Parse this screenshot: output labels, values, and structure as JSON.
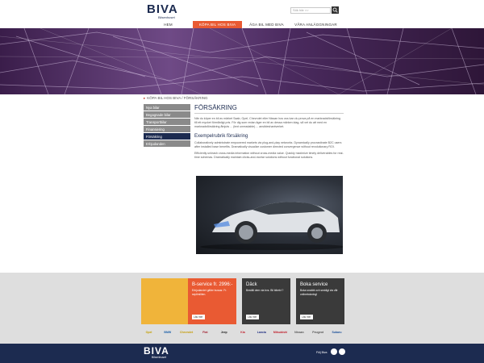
{
  "header": {
    "logo_text": "BIVA",
    "logo_sub": "Bilsenhuset",
    "search_placeholder": "Sök här >>"
  },
  "nav": {
    "items": [
      {
        "label": "Hem"
      },
      {
        "label": "Köpa bil hos Biva"
      },
      {
        "label": "Äga bil med Biva"
      },
      {
        "label": "Våra anläggningar"
      }
    ]
  },
  "breadcrumb": "Köpa bil hos Biva / Försäkring",
  "sidebar": {
    "items": [
      {
        "label": "Nya bilar"
      },
      {
        "label": "Begagnade bilar"
      },
      {
        "label": "Transportbilar"
      },
      {
        "label": "Finansiering"
      },
      {
        "label": "Försäkring"
      },
      {
        "label": "Erbjudanden"
      }
    ]
  },
  "content": {
    "title": "Försäkring",
    "intro": "När du köper en bil av märket Saab, Opel, Chevrolet eller Nissan hos oss kan du prova på en marknadsförsäkring till ett mycket förmånligt pris. För dig som redan äger en bil av dessa märken idag, så vet du att med en marknadsförsäkring åtnjuts ... (text unreadable) ... ansikteshantverket.",
    "subtitle": "Exempelrubrik försäkring",
    "para1": "Collaboratively administrate empowered markets via plug-and-play networks. Dynamically procrastinate B2C users after installed base benefits. Dramatically visualize customer directed convergence without revolutionary ROI.",
    "para2": "Efficiently unleash cross-media information without cross-media value. Quickly maximize timely deliverables for real-time schemas. Dramatically maintain clicks-and-mortar solutions without functional solutions."
  },
  "promos": [
    {
      "title": "B-service fr. 2996:-",
      "text": "Erbjudandet gäller bussar. Fr. sepilmiliten.",
      "button": "Läs mer",
      "color": "#e95a33"
    },
    {
      "title": "Däck",
      "text": "Beställ dem via bvs. Bil bibekt ?",
      "button": "Läs mer",
      "color": "#3a3a3a"
    },
    {
      "title": "Boka service",
      "text": "Boka snabbt och smidigt via vår onlinebokning!",
      "button": "Läs mer",
      "color": "#3a3a3a"
    }
  ],
  "brands": [
    "Opel",
    "BMW",
    "Chevrolet",
    "Fiat",
    "Jeep",
    "Kia",
    "Lancia",
    "Mitsubishi",
    "Nissan",
    "Peugeot",
    "Subaru"
  ],
  "footer": {
    "logo_text": "BIVA",
    "logo_sub": "Bilsenhuset",
    "follow_label": "Följ Biva"
  },
  "colors": {
    "brand_navy": "#1c2b50",
    "accent_orange": "#e95a33"
  }
}
